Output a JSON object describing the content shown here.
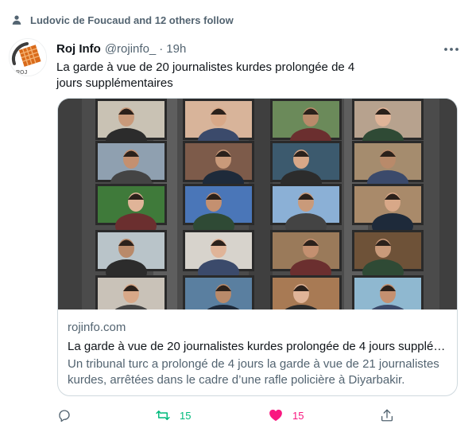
{
  "social_context": {
    "text": "Ludovic de Foucaud and 12 others follow",
    "icon": "person-icon"
  },
  "tweet": {
    "author_name": "Roj Info",
    "handle": "@rojinfo_",
    "separator": "·",
    "time": "19h",
    "text": "La garde à vue de 20 journalistes kurdes prolongée de 4 jours supplémentaires",
    "avatar_text": "ROJ"
  },
  "card": {
    "domain": "rojinfo.com",
    "title": "La garde à vue de 20 journalistes kurdes prolongée de 4 jours supplé…",
    "description": "Un tribunal turc a prolongé de 4 jours la garde à vue de 21 journalistes kurdes, arrêtées dans le cadre d’une rafle policière à Diyarbakir.",
    "image_grid": {
      "rows": 5,
      "cols": 4
    }
  },
  "actions": {
    "reply": {
      "icon": "reply-icon"
    },
    "retweet": {
      "icon": "retweet-icon",
      "count": "15",
      "color": "#00ba7c"
    },
    "like": {
      "icon": "heart-icon",
      "count": "15",
      "color": "#f91880"
    },
    "share": {
      "icon": "share-icon"
    }
  },
  "colors": {
    "secondary_text": "#536471",
    "border": "#cfd9de",
    "text": "#0f1419"
  }
}
